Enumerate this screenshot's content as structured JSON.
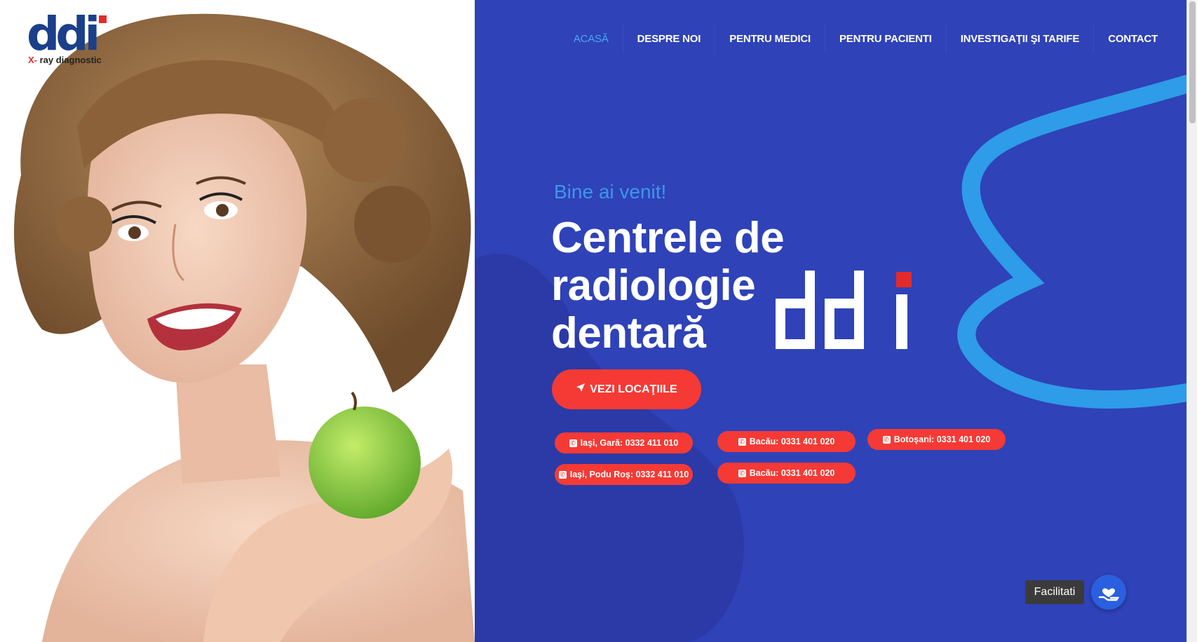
{
  "brand": {
    "logo_word": "ddi",
    "logo_tag_x": "X-",
    "logo_tag_rest": " ray diagnostic",
    "accent_red": "#f53a35",
    "hero_blue": "#2f42b8",
    "light_blue": "#3d97e8"
  },
  "nav": {
    "items": [
      {
        "label": "ACASĂ",
        "active": true
      },
      {
        "label": "DESPRE NOI",
        "active": false
      },
      {
        "label": "PENTRU MEDICI",
        "active": false
      },
      {
        "label": "PENTRU PACIENTI",
        "active": false
      },
      {
        "label": "INVESTIGAŢII ŞI TARIFE",
        "active": false
      },
      {
        "label": "CONTACT",
        "active": false
      }
    ]
  },
  "hero": {
    "welcome": "Bine ai venit!",
    "title_line1": "Centrele de",
    "title_line2": "radiologie",
    "title_line3": "dentară",
    "cta_label": "VEZI LOCAŢIILE",
    "cta_icon": "location-arrow-icon"
  },
  "phones": [
    {
      "label": "Iaşi, Gară: 0332 411 010",
      "icon": "phone-icon"
    },
    {
      "label": "Bacău: 0331 401 020",
      "icon": "phone-icon"
    },
    {
      "label": "Botoşani: 0331 401 020",
      "icon": "phone-icon"
    },
    {
      "label": "Iaşi, Podu Roş: 0332 411 010",
      "icon": "phone-icon"
    },
    {
      "label": "Bacău: 0331 401 020",
      "icon": "phone-icon"
    }
  ],
  "widget": {
    "label": "Facilitati",
    "icon": "hand-heart-icon"
  }
}
